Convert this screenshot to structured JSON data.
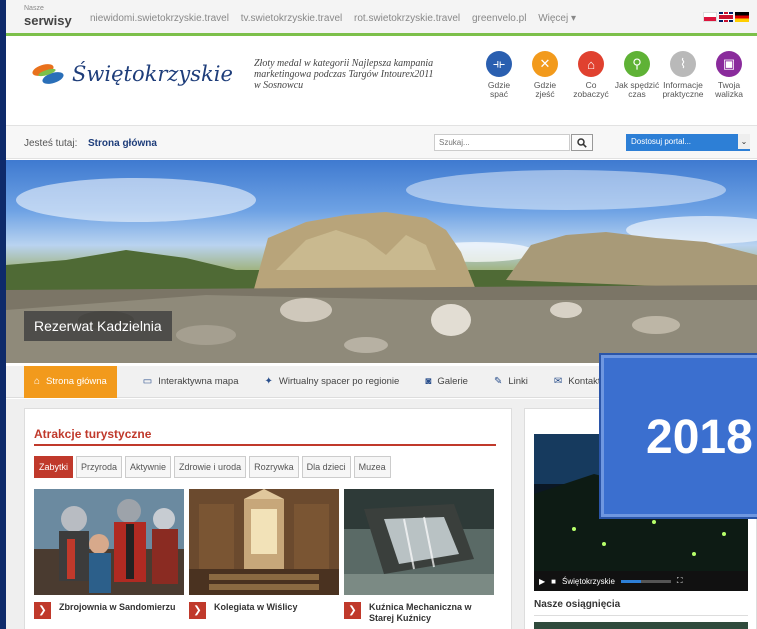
{
  "topbar": {
    "nasze": "Nasze",
    "serwisy": "serwisy",
    "links": [
      "niewidomi.swietokrzyskie.travel",
      "tv.swietokrzyskie.travel",
      "rot.swietokrzyskie.travel",
      "greenvelo.pl",
      "Więcej ▾"
    ]
  },
  "header": {
    "logo_text": "Świętokrzyskie",
    "award": "Złoty medal w kategorii Najlepsza kampania marketingowa podczas Targów Intourex2011 w Sosnowcu",
    "quick_links": [
      {
        "label_line1": "Gdzie",
        "label_line2": "spać",
        "icon": "bed-icon",
        "color": "#2a5fb0",
        "glyph": "⟛"
      },
      {
        "label_line1": "Gdzie",
        "label_line2": "zjeść",
        "icon": "cutlery-icon",
        "color": "#f29a1c",
        "glyph": "✕"
      },
      {
        "label_line1": "Co",
        "label_line2": "zobaczyć",
        "icon": "landmark-icon",
        "color": "#e0412f",
        "glyph": "⌂"
      },
      {
        "label_line1": "Jak spędzić",
        "label_line2": "czas",
        "icon": "bicycle-icon",
        "color": "#5fb236",
        "glyph": "⚲"
      },
      {
        "label_line1": "Informacje",
        "label_line2": "praktyczne",
        "icon": "paperclip-icon",
        "color": "#b9b9b9",
        "glyph": "⌇"
      },
      {
        "label_line1": "Twoja",
        "label_line2": "walizka",
        "icon": "suitcase-icon",
        "color": "#8a2b9c",
        "glyph": "▣"
      }
    ]
  },
  "breadcrumb": {
    "prefix": "Jesteś tutaj:",
    "current": "Strona główna"
  },
  "search": {
    "placeholder": "Szukaj..."
  },
  "customize": {
    "label": "Dostosuj portal..."
  },
  "hero": {
    "caption": "Rezerwat Kadzielnia"
  },
  "nav": [
    {
      "label": "Strona główna",
      "icon": "home-icon",
      "glyph": "⌂",
      "active": true
    },
    {
      "label": "Interaktywna mapa",
      "icon": "monitor-icon",
      "glyph": "▭",
      "active": false
    },
    {
      "label": "Wirtualny spacer po regionie",
      "icon": "walker-icon",
      "glyph": "✦",
      "active": false
    },
    {
      "label": "Galerie",
      "icon": "camera-icon",
      "glyph": "◙",
      "active": false
    },
    {
      "label": "Linki",
      "icon": "edit-icon",
      "glyph": "✎",
      "active": false
    },
    {
      "label": "Kontakt",
      "icon": "mail-icon",
      "glyph": "✉",
      "active": false
    }
  ],
  "attractions": {
    "title": "Atrakcje turystyczne",
    "categories": [
      "Zabytki",
      "Przyroda",
      "Aktywnie",
      "Zdrowie i uroda",
      "Rozrywka",
      "Dla dzieci",
      "Muzea"
    ],
    "items": [
      {
        "title": "Zbrojownia w Sandomierzu"
      },
      {
        "title": "Kolegiata w Wiślicy"
      },
      {
        "title": "Kuźnica Mechaniczna w Starej Kuźnicy"
      }
    ]
  },
  "side": {
    "video_brand": "Świętokrzyskie",
    "achievements_title": "Nasze osiągnięcia"
  },
  "overlay": {
    "year": "2018"
  },
  "colors": {
    "accent": "#f29a1c",
    "red": "#c0392b",
    "navy": "#1e3d7a",
    "green": "#7cc04a"
  }
}
